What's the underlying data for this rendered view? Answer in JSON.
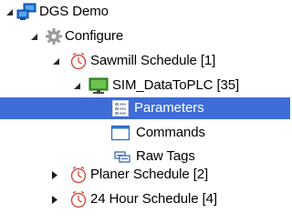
{
  "tree": {
    "nodes": [
      {
        "label": "DGS Demo",
        "icon": "network-computers-icon",
        "expanded": true
      },
      {
        "label": "Configure",
        "icon": "gear-icon",
        "expanded": true
      },
      {
        "label": "Sawmill Schedule [1]",
        "icon": "clock-schedule-icon",
        "expanded": true
      },
      {
        "label": "SIM_DataToPLC [35]",
        "icon": "monitor-icon",
        "expanded": true
      },
      {
        "label": "Parameters",
        "icon": "parameters-list-icon",
        "selected": true
      },
      {
        "label": "Commands",
        "icon": "window-icon"
      },
      {
        "label": "Raw Tags",
        "icon": "tags-icon"
      },
      {
        "label": "Planer Schedule [2]",
        "icon": "clock-schedule-icon",
        "expanded": false
      },
      {
        "label": "24 Hour Schedule [4]",
        "icon": "clock-schedule-icon",
        "expanded": false
      }
    ]
  },
  "colors": {
    "selection": "#3f6dd8",
    "monitor_green": "#3c9b2a",
    "network_blue": "#1d6fd1",
    "clock_red": "#d84a3c"
  }
}
